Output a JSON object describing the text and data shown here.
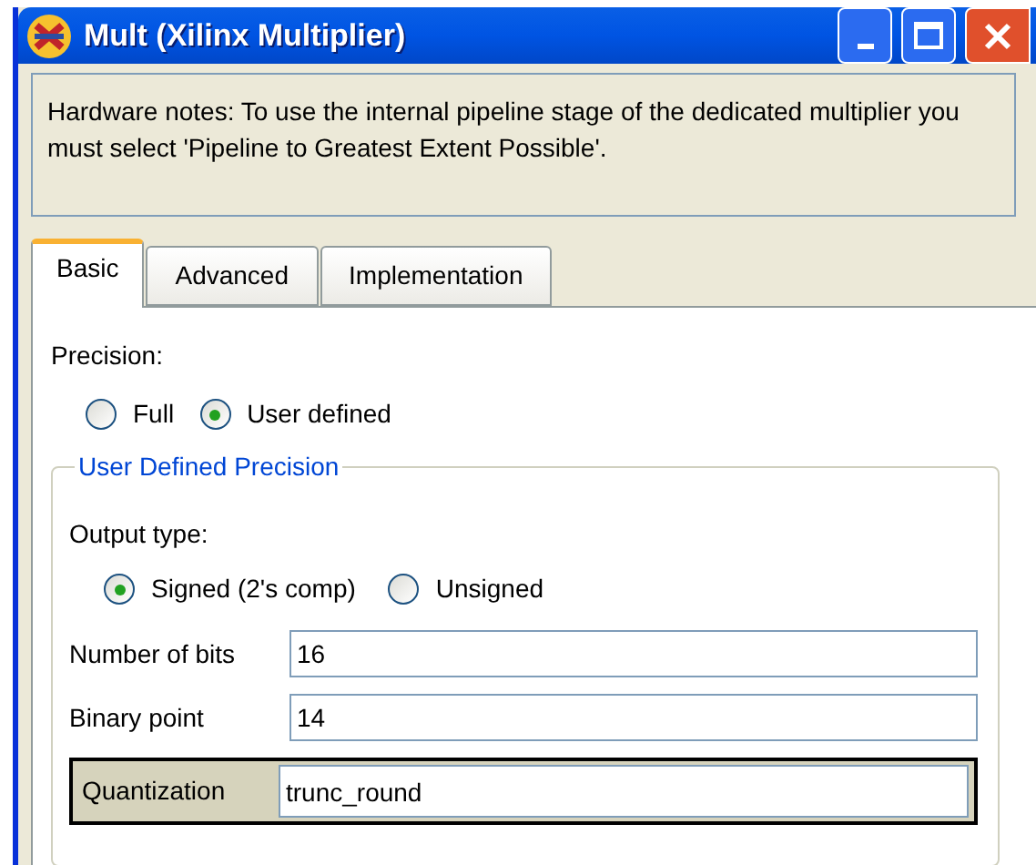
{
  "window": {
    "title": "Mult (Xilinx Multiplier)"
  },
  "notes": "Hardware notes: To use the internal pipeline stage of the dedicated multiplier you must select 'Pipeline to Greatest Extent Possible'.",
  "tabs": [
    {
      "label": "Basic",
      "selected": true
    },
    {
      "label": "Advanced",
      "selected": false
    },
    {
      "label": "Implementation",
      "selected": false
    }
  ],
  "precision": {
    "label": "Precision:",
    "options": [
      {
        "label": "Full",
        "selected": false
      },
      {
        "label": "User defined",
        "selected": true
      }
    ]
  },
  "user_defined_precision": {
    "legend": "User Defined Precision",
    "output_type": {
      "label": "Output type:",
      "options": [
        {
          "label": "Signed (2's comp)",
          "selected": true
        },
        {
          "label": "Unsigned",
          "selected": false
        }
      ]
    },
    "fields": [
      {
        "label": "Number of bits",
        "value": "16",
        "highlighted": false
      },
      {
        "label": "Binary point",
        "value": "14",
        "highlighted": false
      },
      {
        "label": "Quantization",
        "value": "trunc_round",
        "highlighted": true
      }
    ]
  }
}
